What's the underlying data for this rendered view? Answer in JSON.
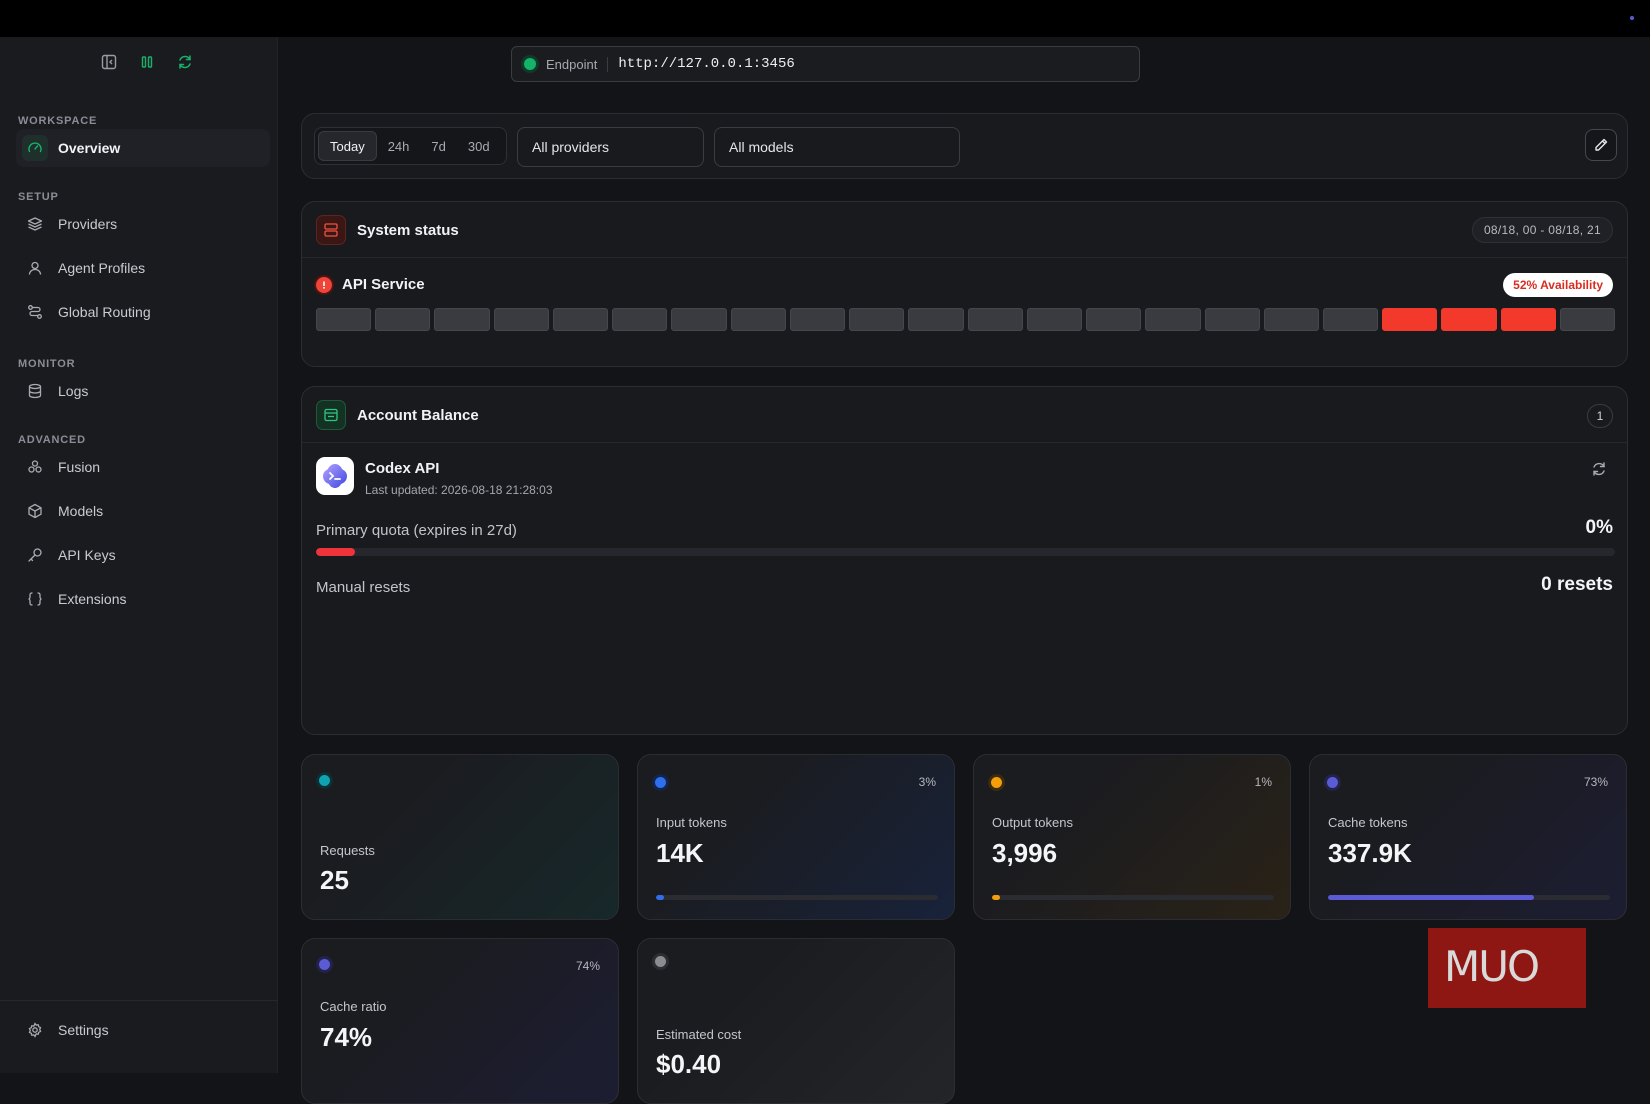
{
  "endpoint": {
    "label": "Endpoint",
    "url": "http://127.0.0.1:3456"
  },
  "sidebar": {
    "sections": {
      "workspace": "WORKSPACE",
      "setup": "SETUP",
      "monitor": "MONITOR",
      "advanced": "ADVANCED"
    },
    "items": {
      "overview": "Overview",
      "providers": "Providers",
      "agent_profiles": "Agent Profiles",
      "global_routing": "Global Routing",
      "logs": "Logs",
      "fusion": "Fusion",
      "models": "Models",
      "api_keys": "API Keys",
      "extensions": "Extensions",
      "settings": "Settings"
    }
  },
  "filters": {
    "ranges": [
      "Today",
      "24h",
      "7d",
      "30d"
    ],
    "selected_range": "Today",
    "providers": "All providers",
    "models": "All models"
  },
  "system_status": {
    "title": "System status",
    "date_range": "08/18, 00 - 08/18, 21",
    "service_name": "API Service",
    "availability": "52% Availability",
    "hours": [
      "ok",
      "ok",
      "ok",
      "ok",
      "ok",
      "ok",
      "ok",
      "ok",
      "ok",
      "ok",
      "ok",
      "ok",
      "ok",
      "ok",
      "ok",
      "ok",
      "ok",
      "ok",
      "down",
      "down",
      "down",
      "ok"
    ]
  },
  "account_balance": {
    "title": "Account Balance",
    "count": "1",
    "provider_name": "Codex API",
    "last_updated": "Last updated: 2026-08-18 21:28:03",
    "quota_label": "Primary quota (expires in 27d)",
    "quota_value": "0%",
    "quota_fill_percent": 3,
    "resets_label": "Manual resets",
    "resets_value": "0 resets"
  },
  "stats": {
    "requests": {
      "label": "Requests",
      "value": "25"
    },
    "input_tokens": {
      "label": "Input tokens",
      "value": "14K",
      "pct": "3%",
      "fill": 3
    },
    "output_tokens": {
      "label": "Output tokens",
      "value": "3,996",
      "pct": "1%",
      "fill": 3
    },
    "cache_tokens": {
      "label": "Cache tokens",
      "value": "337.9K",
      "pct": "73%",
      "fill": 73
    },
    "cache_ratio": {
      "label": "Cache ratio",
      "value": "74%",
      "pct": "74%"
    },
    "estimated_cost": {
      "label": "Estimated cost",
      "value": "$0.40"
    }
  },
  "colors": {
    "accent_green": "#17b26a",
    "teal": "#0fa3b1",
    "blue": "#2f6fed",
    "orange": "#f59e0b",
    "indigo": "#5b5bd6",
    "red": "#f2392b"
  },
  "watermark": "MUO"
}
